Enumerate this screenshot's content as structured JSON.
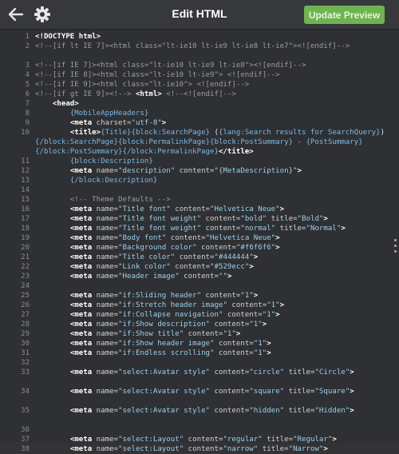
{
  "header": {
    "title": "Edit HTML",
    "update_label": "Update Preview"
  },
  "editor": {
    "lines": [
      {
        "n": "1",
        "segs": [
          [
            "tag",
            "<!DOCTYPE html>"
          ]
        ]
      },
      {
        "n": "2",
        "segs": [
          [
            "cm",
            "<!--[if lt IE 7]><html class=\"lt-ie10 lt-ie9 lt-ie8 lt-ie7\"><![endif]-->"
          ]
        ]
      },
      {
        "n": "3",
        "segs": [
          [
            "cm",
            "<!--[if IE 7]><html class=\"lt-ie10 lt-ie9 lt-ie8\"><![endif]-->"
          ]
        ]
      },
      {
        "n": "4",
        "segs": [
          [
            "cm",
            "<!--[if IE 8]><html class=\"lt-ie10 lt-ie9\"> <![endif]-->"
          ]
        ]
      },
      {
        "n": "5",
        "segs": [
          [
            "cm",
            "<!--[if IE 9]><html class=\"lt-ie10\"> <![endif]-->"
          ]
        ]
      },
      {
        "n": "6",
        "segs": [
          [
            "cm",
            "<!--[if gt IE 9]><!--> "
          ],
          [
            "tag",
            "<html>"
          ],
          [
            "cm",
            " <!--<![endif]-->"
          ]
        ]
      },
      {
        "n": "7",
        "segs": [
          [
            "txt",
            "    "
          ],
          [
            "tag",
            "<head>"
          ]
        ]
      },
      {
        "n": "8",
        "segs": [
          [
            "txt",
            "        "
          ],
          [
            "tmb",
            "{MobileAppHeaders}"
          ]
        ]
      },
      {
        "n": "9",
        "segs": [
          [
            "txt",
            "        "
          ],
          [
            "tag",
            "<meta"
          ],
          [
            "attr",
            " charset="
          ],
          [
            "val",
            "\"utf-8\""
          ],
          [
            "tag",
            ">"
          ]
        ]
      },
      {
        "n": "10",
        "segs": [
          [
            "txt",
            "        "
          ],
          [
            "tag",
            "<title>"
          ],
          [
            "tmb",
            "{Title}{block:SearchPage}"
          ],
          [
            "txt",
            " ("
          ],
          [
            "tmb",
            "{lang:Search results for SearchQuery}"
          ],
          [
            "txt",
            ")"
          ],
          [
            "tmb",
            "{/block:SearchPage}{block:PermalinkPage}{block:PostSummary} - {PostSummary}{/block:PostSummary}{/block:PermalinkPage}"
          ],
          [
            "tag",
            "</title>"
          ]
        ]
      },
      {
        "n": "11",
        "segs": [
          [
            "txt",
            "        "
          ],
          [
            "tmb",
            "{block:Description}"
          ]
        ]
      },
      {
        "n": "12",
        "segs": [
          [
            "txt",
            "        "
          ],
          [
            "tag",
            "<meta"
          ],
          [
            "attr",
            " name="
          ],
          [
            "val",
            "\"description\""
          ],
          [
            "attr",
            " content="
          ],
          [
            "val",
            "\"{MetaDescription}\""
          ],
          [
            "tag",
            ">"
          ]
        ]
      },
      {
        "n": "13",
        "segs": [
          [
            "txt",
            "        "
          ],
          [
            "tmb",
            "{/block:Description}"
          ]
        ]
      },
      {
        "n": "14",
        "segs": [
          [
            "txt",
            ""
          ]
        ]
      },
      {
        "n": "15",
        "segs": [
          [
            "txt",
            "        "
          ],
          [
            "cm",
            "<!-- Theme Defaults -->"
          ]
        ]
      },
      {
        "n": "16",
        "segs": [
          [
            "txt",
            "        "
          ],
          [
            "tag",
            "<meta"
          ],
          [
            "attr",
            " name="
          ],
          [
            "val",
            "\"Title font\""
          ],
          [
            "attr",
            " content="
          ],
          [
            "val",
            "\"Helvetica Neue\""
          ],
          [
            "tag",
            ">"
          ]
        ]
      },
      {
        "n": "17",
        "segs": [
          [
            "txt",
            "        "
          ],
          [
            "tag",
            "<meta"
          ],
          [
            "attr",
            " name="
          ],
          [
            "val",
            "\"Title font weight\""
          ],
          [
            "attr",
            " content="
          ],
          [
            "val",
            "\"bold\""
          ],
          [
            "attr",
            " title="
          ],
          [
            "val",
            "\"Bold\""
          ],
          [
            "tag",
            ">"
          ]
        ]
      },
      {
        "n": "18",
        "segs": [
          [
            "txt",
            "        "
          ],
          [
            "tag",
            "<meta"
          ],
          [
            "attr",
            " name="
          ],
          [
            "val",
            "\"Title font weight\""
          ],
          [
            "attr",
            " content="
          ],
          [
            "val",
            "\"normal\""
          ],
          [
            "attr",
            " title="
          ],
          [
            "val",
            "\"Normal\""
          ],
          [
            "tag",
            ">"
          ]
        ]
      },
      {
        "n": "19",
        "segs": [
          [
            "txt",
            "        "
          ],
          [
            "tag",
            "<meta"
          ],
          [
            "attr",
            " name="
          ],
          [
            "val",
            "\"Body font\""
          ],
          [
            "attr",
            " content="
          ],
          [
            "val",
            "\"Helvetica Neue\""
          ],
          [
            "tag",
            ">"
          ]
        ]
      },
      {
        "n": "20",
        "segs": [
          [
            "txt",
            "        "
          ],
          [
            "tag",
            "<meta"
          ],
          [
            "attr",
            " name="
          ],
          [
            "val",
            "\"Background color\""
          ],
          [
            "attr",
            " content="
          ],
          [
            "val",
            "\"#f6f6f6\""
          ],
          [
            "tag",
            ">"
          ]
        ]
      },
      {
        "n": "21",
        "segs": [
          [
            "txt",
            "        "
          ],
          [
            "tag",
            "<meta"
          ],
          [
            "attr",
            " name="
          ],
          [
            "val",
            "\"Title color\""
          ],
          [
            "attr",
            " content="
          ],
          [
            "val",
            "\"#444444\""
          ],
          [
            "tag",
            ">"
          ]
        ]
      },
      {
        "n": "22",
        "segs": [
          [
            "txt",
            "        "
          ],
          [
            "tag",
            "<meta"
          ],
          [
            "attr",
            " name="
          ],
          [
            "val",
            "\"Link color\""
          ],
          [
            "attr",
            " content="
          ],
          [
            "val",
            "\"#529ecc\""
          ],
          [
            "tag",
            ">"
          ]
        ]
      },
      {
        "n": "23",
        "segs": [
          [
            "txt",
            "        "
          ],
          [
            "tag",
            "<meta"
          ],
          [
            "attr",
            " name="
          ],
          [
            "val",
            "\"Header image\""
          ],
          [
            "attr",
            " content="
          ],
          [
            "val",
            "\"\""
          ],
          [
            "tag",
            ">"
          ]
        ]
      },
      {
        "n": "24",
        "segs": [
          [
            "txt",
            ""
          ]
        ]
      },
      {
        "n": "25",
        "segs": [
          [
            "txt",
            "        "
          ],
          [
            "tag",
            "<meta"
          ],
          [
            "attr",
            " name="
          ],
          [
            "val",
            "\"if:Sliding header\""
          ],
          [
            "attr",
            " content="
          ],
          [
            "val",
            "\"1\""
          ],
          [
            "tag",
            ">"
          ]
        ]
      },
      {
        "n": "26",
        "segs": [
          [
            "txt",
            "        "
          ],
          [
            "tag",
            "<meta"
          ],
          [
            "attr",
            " name="
          ],
          [
            "val",
            "\"if:Stretch header image\""
          ],
          [
            "attr",
            " content="
          ],
          [
            "val",
            "\"1\""
          ],
          [
            "tag",
            ">"
          ]
        ]
      },
      {
        "n": "27",
        "segs": [
          [
            "txt",
            "        "
          ],
          [
            "tag",
            "<meta"
          ],
          [
            "attr",
            " name="
          ],
          [
            "val",
            "\"if:Collapse navigation\""
          ],
          [
            "attr",
            " content="
          ],
          [
            "val",
            "\"1\""
          ],
          [
            "tag",
            ">"
          ]
        ]
      },
      {
        "n": "28",
        "segs": [
          [
            "txt",
            "        "
          ],
          [
            "tag",
            "<meta"
          ],
          [
            "attr",
            " name="
          ],
          [
            "val",
            "\"if:Show description\""
          ],
          [
            "attr",
            " content="
          ],
          [
            "val",
            "\"1\""
          ],
          [
            "tag",
            ">"
          ]
        ]
      },
      {
        "n": "29",
        "segs": [
          [
            "txt",
            "        "
          ],
          [
            "tag",
            "<meta"
          ],
          [
            "attr",
            " name="
          ],
          [
            "val",
            "\"if:Show title\""
          ],
          [
            "attr",
            " content="
          ],
          [
            "val",
            "\"1\""
          ],
          [
            "tag",
            ">"
          ]
        ]
      },
      {
        "n": "30",
        "segs": [
          [
            "txt",
            "        "
          ],
          [
            "tag",
            "<meta"
          ],
          [
            "attr",
            " name="
          ],
          [
            "val",
            "\"if:Show header image\""
          ],
          [
            "attr",
            " content="
          ],
          [
            "val",
            "\"1\""
          ],
          [
            "tag",
            ">"
          ]
        ]
      },
      {
        "n": "31",
        "segs": [
          [
            "txt",
            "        "
          ],
          [
            "tag",
            "<meta"
          ],
          [
            "attr",
            " name="
          ],
          [
            "val",
            "\"if:Endless scrolling\""
          ],
          [
            "attr",
            " content="
          ],
          [
            "val",
            "\"1\""
          ],
          [
            "tag",
            ">"
          ]
        ]
      },
      {
        "n": "32",
        "segs": [
          [
            "txt",
            ""
          ]
        ]
      },
      {
        "n": "33",
        "segs": [
          [
            "txt",
            "        "
          ],
          [
            "tag",
            "<meta"
          ],
          [
            "attr",
            " name="
          ],
          [
            "val",
            "\"select:Avatar style\""
          ],
          [
            "attr",
            " content="
          ],
          [
            "val",
            "\"circle\""
          ],
          [
            "attr",
            " title="
          ],
          [
            "val",
            "\"Circle\""
          ],
          [
            "tag",
            ">"
          ]
        ]
      },
      {
        "n": "34",
        "segs": [
          [
            "txt",
            "        "
          ],
          [
            "tag",
            "<meta"
          ],
          [
            "attr",
            " name="
          ],
          [
            "val",
            "\"select:Avatar style\""
          ],
          [
            "attr",
            " content="
          ],
          [
            "val",
            "\"square\""
          ],
          [
            "attr",
            " title="
          ],
          [
            "val",
            "\"Square\""
          ],
          [
            "tag",
            ">"
          ]
        ]
      },
      {
        "n": "35",
        "segs": [
          [
            "txt",
            "        "
          ],
          [
            "tag",
            "<meta"
          ],
          [
            "attr",
            " name="
          ],
          [
            "val",
            "\"select:Avatar style\""
          ],
          [
            "attr",
            " content="
          ],
          [
            "val",
            "\"hidden\""
          ],
          [
            "attr",
            " title="
          ],
          [
            "val",
            "\"Hidden\""
          ],
          [
            "tag",
            ">"
          ]
        ]
      },
      {
        "n": "36",
        "segs": [
          [
            "txt",
            ""
          ]
        ]
      },
      {
        "n": "37",
        "segs": [
          [
            "txt",
            "        "
          ],
          [
            "tag",
            "<meta"
          ],
          [
            "attr",
            " name="
          ],
          [
            "val",
            "\"select:Layout\""
          ],
          [
            "attr",
            " content="
          ],
          [
            "val",
            "\"regular\""
          ],
          [
            "attr",
            " title="
          ],
          [
            "val",
            "\"Regular\""
          ],
          [
            "tag",
            ">"
          ]
        ]
      },
      {
        "n": "38",
        "segs": [
          [
            "txt",
            "        "
          ],
          [
            "tag",
            "<meta"
          ],
          [
            "attr",
            " name="
          ],
          [
            "val",
            "\"select:Layout\""
          ],
          [
            "attr",
            " content="
          ],
          [
            "val",
            "\"narrow\""
          ],
          [
            "attr",
            " title="
          ],
          [
            "val",
            "\"Narrow\""
          ],
          [
            "tag",
            ">"
          ]
        ]
      }
    ]
  }
}
